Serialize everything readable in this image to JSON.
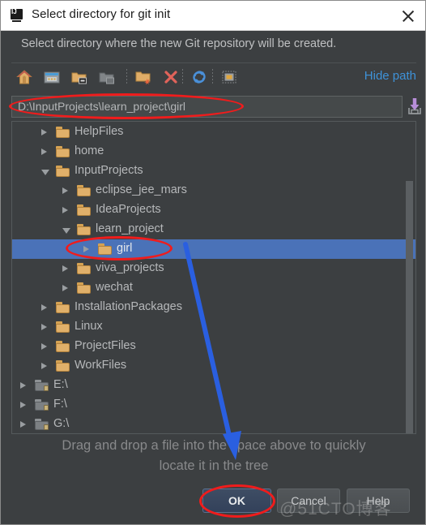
{
  "window": {
    "title": "Select directory for git init",
    "app_icon": "intellij-idea-icon",
    "close_label": "×"
  },
  "subtitle": "Select directory where the new Git repository will be created.",
  "toolbar": {
    "items": [
      {
        "name": "home-icon",
        "tooltip": "Home"
      },
      {
        "name": "desktop-icon",
        "tooltip": "Desktop"
      },
      {
        "name": "project-folder-icon",
        "tooltip": "Project Directory"
      },
      {
        "name": "module-folder-icon",
        "tooltip": "Module Directory"
      },
      {
        "name": "new-folder-icon",
        "tooltip": "New Folder"
      },
      {
        "name": "delete-icon",
        "tooltip": "Delete"
      },
      {
        "name": "refresh-icon",
        "tooltip": "Refresh"
      },
      {
        "name": "show-hidden-files-icon",
        "tooltip": "Show Hidden Files"
      }
    ],
    "hide_path_label": "Hide path"
  },
  "path": {
    "value": "D:\\InputProjects\\learn_project\\girl",
    "placeholder": "",
    "save_icon": "save-to-history-icon"
  },
  "tree": {
    "rows": [
      {
        "label": "HelpFiles",
        "depth": 1,
        "state": "collapsed",
        "icon": "folder-icon",
        "selected": false
      },
      {
        "label": "home",
        "depth": 1,
        "state": "collapsed",
        "icon": "folder-icon",
        "selected": false
      },
      {
        "label": "InputProjects",
        "depth": 1,
        "state": "expanded",
        "icon": "folder-icon",
        "selected": false
      },
      {
        "label": "eclipse_jee_mars",
        "depth": 2,
        "state": "collapsed",
        "icon": "folder-icon",
        "selected": false
      },
      {
        "label": "IdeaProjects",
        "depth": 2,
        "state": "collapsed",
        "icon": "folder-icon",
        "selected": false
      },
      {
        "label": "learn_project",
        "depth": 2,
        "state": "expanded",
        "icon": "folder-icon",
        "selected": false
      },
      {
        "label": "girl",
        "depth": 3,
        "state": "collapsed",
        "icon": "folder-icon",
        "selected": true
      },
      {
        "label": "viva_projects",
        "depth": 2,
        "state": "collapsed",
        "icon": "folder-icon",
        "selected": false
      },
      {
        "label": "wechat",
        "depth": 2,
        "state": "collapsed",
        "icon": "folder-icon",
        "selected": false
      },
      {
        "label": "InstallationPackages",
        "depth": 1,
        "state": "collapsed",
        "icon": "folder-icon",
        "selected": false
      },
      {
        "label": "Linux",
        "depth": 1,
        "state": "collapsed",
        "icon": "folder-icon",
        "selected": false
      },
      {
        "label": "ProjectFiles",
        "depth": 1,
        "state": "collapsed",
        "icon": "folder-icon",
        "selected": false
      },
      {
        "label": "WorkFiles",
        "depth": 1,
        "state": "collapsed",
        "icon": "folder-icon",
        "selected": false
      },
      {
        "label": "E:\\",
        "depth": 0,
        "state": "collapsed",
        "icon": "drive-folder-icon",
        "selected": false
      },
      {
        "label": "F:\\",
        "depth": 0,
        "state": "collapsed",
        "icon": "drive-folder-icon",
        "selected": false
      },
      {
        "label": "G:\\",
        "depth": 0,
        "state": "collapsed",
        "icon": "drive-folder-icon",
        "selected": false
      }
    ],
    "scrollbar": {
      "name": "vertical-scrollbar"
    }
  },
  "hint": {
    "line1": "Drag and drop a file into the space above to quickly",
    "line2": "locate it in the tree"
  },
  "buttons": {
    "ok": "OK",
    "cancel": "Cancel",
    "help": "Help"
  },
  "watermark": "@51CTO博客",
  "colors": {
    "dialog_bg": "#3c3f41",
    "titlebar_bg": "#ffffff",
    "selection_blue": "#4a72b8",
    "link_blue": "#3e92d8",
    "annotation_red": "#f01c1c",
    "annotation_blue": "#2a5fe0",
    "text_primary": "#b6b8ba",
    "folder_gold": "#e0b06a"
  },
  "annotations": {
    "ellipse_path": "highlight-path-field",
    "ellipse_girl": "highlight-girl-node",
    "ellipse_ok": "highlight-ok-button",
    "arrow": "pointer-arrow-to-ok"
  }
}
